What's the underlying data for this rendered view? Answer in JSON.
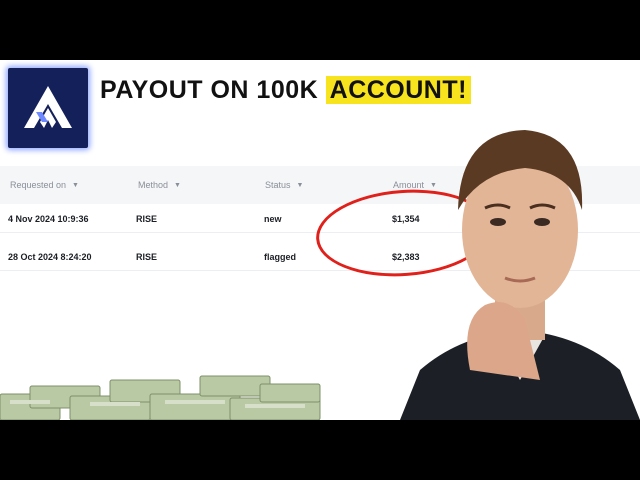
{
  "title": {
    "prefix": "PAYOUT ON 100K",
    "highlight": "ACCOUNT!"
  },
  "table": {
    "headers": [
      "Requested on",
      "Method",
      "Status",
      "Amount"
    ],
    "rows": [
      {
        "date": "4 Nov 2024 10:9:36",
        "method": "RISE",
        "status": "new",
        "amount": "$1,354"
      },
      {
        "date": "28 Oct 2024 8:24:20",
        "method": "RISE",
        "status": "flagged",
        "amount": "$2,383"
      }
    ]
  },
  "colors": {
    "highlight": "#f7e41e",
    "circle": "#e0201a",
    "logo_bg": "#14205a",
    "logo_glow": "#8fa8ff"
  },
  "icons": {
    "logo": "mountain-logo-icon",
    "sort": "caret-down-icon"
  }
}
